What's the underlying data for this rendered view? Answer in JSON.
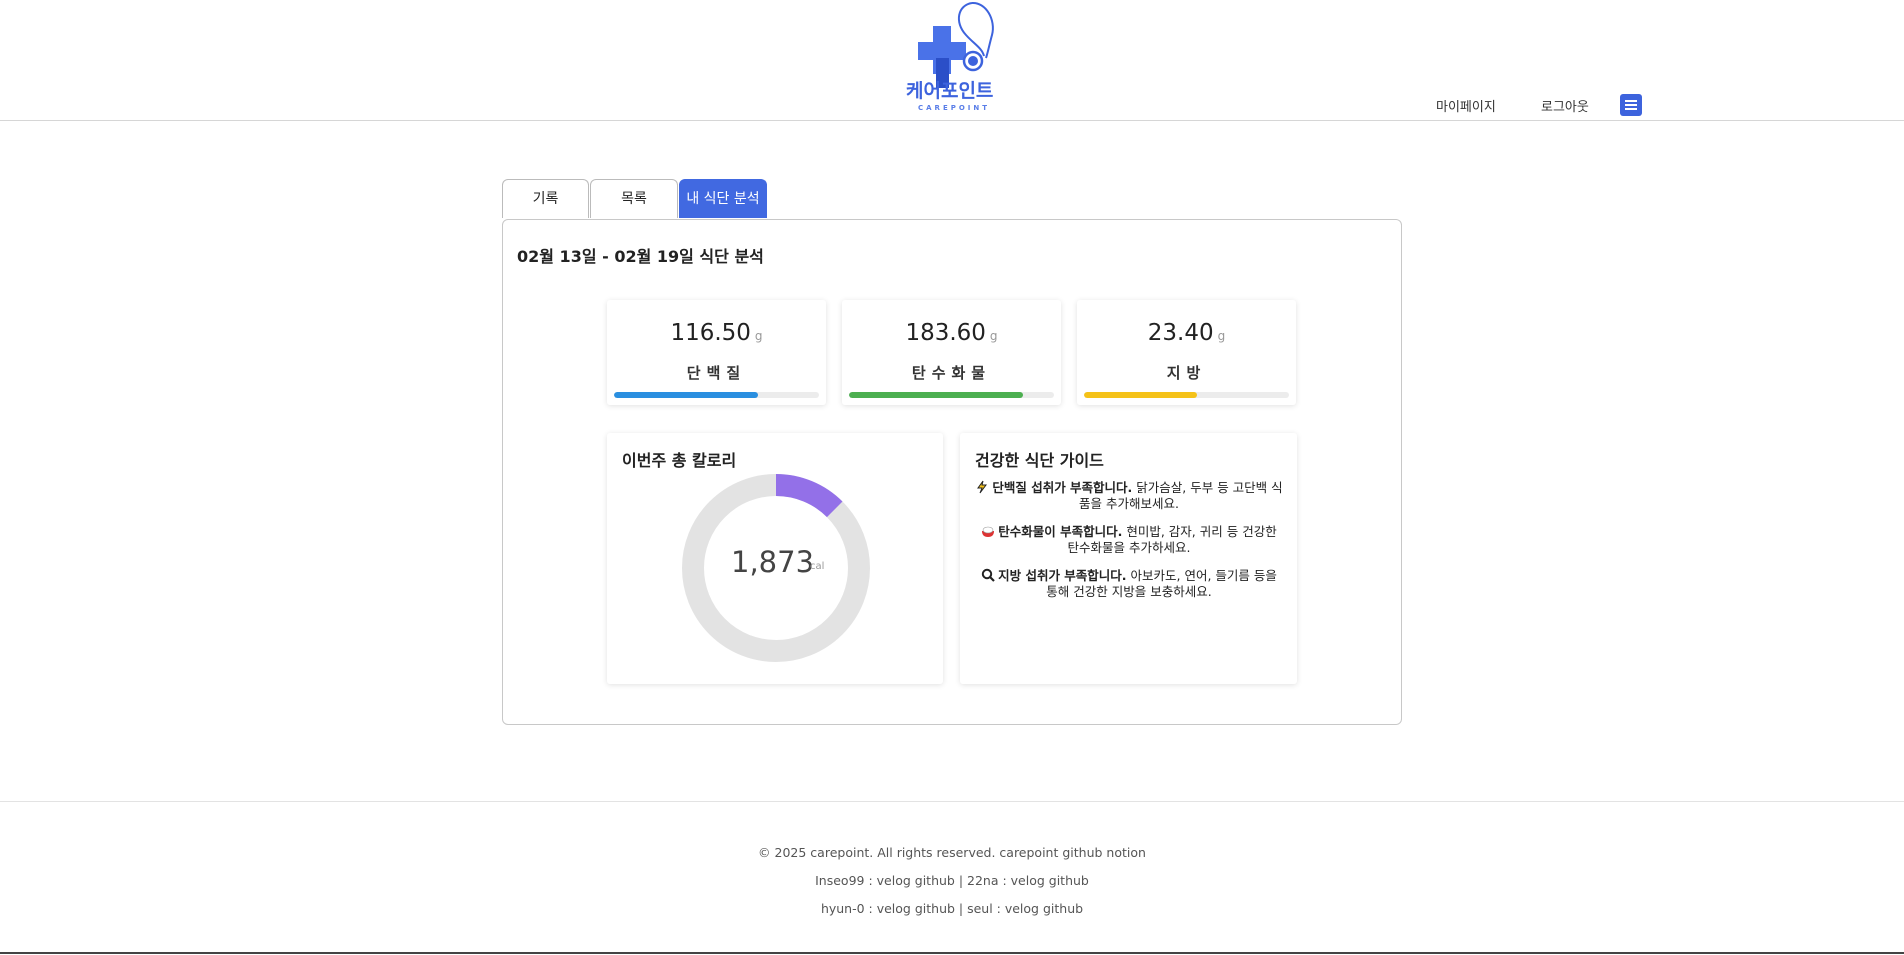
{
  "header": {
    "logo_text": "케어포인트",
    "logo_sub": "CAREPOINT",
    "nav": {
      "mypage": "마이페이지",
      "logout": "로그아웃"
    },
    "menu_icon": "hamburger-icon",
    "brand_color": "#3d63dd"
  },
  "tabs": [
    {
      "label": "기록",
      "active": false
    },
    {
      "label": "목록",
      "active": false
    },
    {
      "label": "내 식단 분석",
      "active": true
    }
  ],
  "analysis": {
    "range_title": "02월 13일 - 02월 19일 식단 분석",
    "macros": [
      {
        "value": "116.50",
        "unit": "g",
        "label": "단백질",
        "progress": 0.7,
        "color": "#2a8fe0"
      },
      {
        "value": "183.60",
        "unit": "g",
        "label": "탄수화물",
        "progress": 0.85,
        "color": "#4caf50"
      },
      {
        "value": "23.40",
        "unit": "g",
        "label": "지방",
        "progress": 0.55,
        "color": "#f5c218"
      }
    ],
    "calories": {
      "title": "이번주 총 칼로리",
      "value": "1,873",
      "unit": "cal",
      "ring_fraction": 0.125,
      "ring_color": "#9370e8",
      "track_color": "#e3e3e3"
    },
    "guide": {
      "title": "건강한 식단 가이드",
      "items": [
        {
          "icon": "lightning-icon",
          "bold": "단백질 섭취가 부족합니다.",
          "text": " 닭가슴살, 두부 등 고단백 식품을 추가해보세요."
        },
        {
          "icon": "rice-bowl-icon",
          "bold": "탄수화물이 부족합니다.",
          "text": " 현미밥, 감자, 귀리 등 건강한 탄수화물을 추가하세요."
        },
        {
          "icon": "magnifier-icon",
          "bold": "지방 섭취가 부족합니다.",
          "text": " 아보카도, 연어, 들기름 등을 통해 건강한 지방을 보충하세요."
        }
      ]
    }
  },
  "footer": {
    "line1": "© 2025 carepoint. All rights reserved. carepoint github notion",
    "line2": "Inseo99 : velog github | 22na : velog github",
    "line3": "hyun-0 : velog github | seul : velog github"
  }
}
